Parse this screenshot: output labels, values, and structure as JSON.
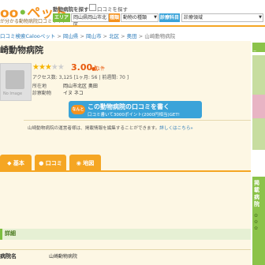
{
  "header": {
    "logo_part1": "oo",
    "logo_part2": "ペット",
    "tagline": "が分かる動物病院口コミサイト",
    "search_label": "動物病院を探す",
    "review_search_label": "口コミを探す",
    "area_tag": "エリア",
    "area_value": "岡山県岡山市北区",
    "type_tag": "種類",
    "type_value": "動物の種類",
    "dept_tag": "診療科目",
    "dept_value": "診療領域",
    "accent": "#f5a623",
    "green": "#7cbf3f"
  },
  "breadcrumb": {
    "home": "口コミ検索Calooペット",
    "sep": " > ",
    "items": [
      "岡山県",
      "岡山市",
      "北区",
      "奥田",
      "山崎動物病院"
    ]
  },
  "hospital": {
    "name": "崎動物病院",
    "photo_text": "No Image",
    "stars_on": "★★★",
    "stars_off": "★★",
    "score": "3.00",
    "score_suffix": "点",
    "rank_label": "1件",
    "access_text": "アクセス数: 3,125 [1ヶ月: 56 | 前週間: 70 ]",
    "location_label": "所在地",
    "location_value": "岡山市北区 奥田",
    "animals_label": "診察動物",
    "animals_value": "イヌ  ネコ"
  },
  "review_banner": {
    "badge": "なんと",
    "main": "この動物病院の口コミを書く",
    "sub": "口コミ書いて3000ポイント(2000円相当)GET!"
  },
  "note": {
    "text": "山崎動物病院の運営者様は、掲載情報を編集することができます。",
    "link": "詳しくはこちら»"
  },
  "tabs": [
    {
      "label": "基本",
      "icon": "◆",
      "color": "#f5a623"
    },
    {
      "label": "口コミ",
      "icon": "●",
      "color": "#f5a623"
    },
    {
      "label": "地図",
      "icon": "◉",
      "color": "#f5a623"
    }
  ],
  "detail": {
    "title": "詳細",
    "row_label": "病院名",
    "row_value": "山崎動物病院"
  },
  "right_sidebar": {
    "top_label": "こ",
    "green_text": "掲載病院"
  }
}
